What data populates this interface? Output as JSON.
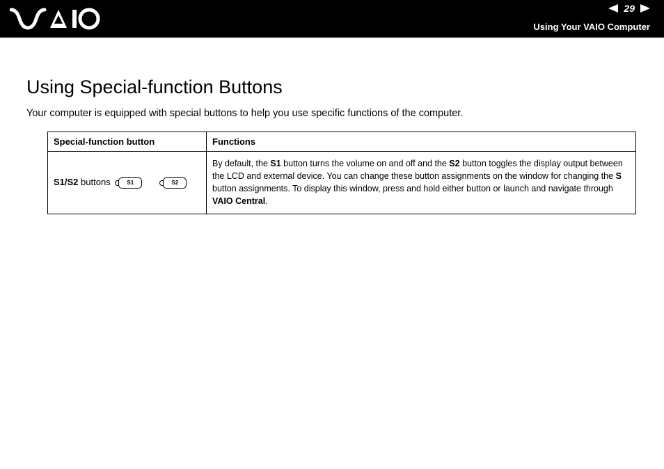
{
  "header": {
    "page_number": "29",
    "section": "Using Your VAIO Computer"
  },
  "page": {
    "heading": "Using Special-function Buttons",
    "intro": "Your computer is equipped with special buttons to help you use specific functions of the computer."
  },
  "table": {
    "col1_header": "Special-function button",
    "col2_header": "Functions",
    "row1": {
      "label_bold": "S1/S2",
      "label_rest": " buttons",
      "key1": "S1",
      "key2": "S2",
      "func": {
        "t1": "By default, the ",
        "b1": "S1",
        "t2": " button turns the volume on and off and the ",
        "b2": "S2",
        "t3": " button toggles the display output between the LCD and external device. You can change these button assignments on the window for changing the ",
        "b3": "S",
        "t4": " button assignments. To display this window, press and hold either button or launch and navigate through ",
        "b4": "VAIO Central",
        "t5": "."
      }
    }
  }
}
